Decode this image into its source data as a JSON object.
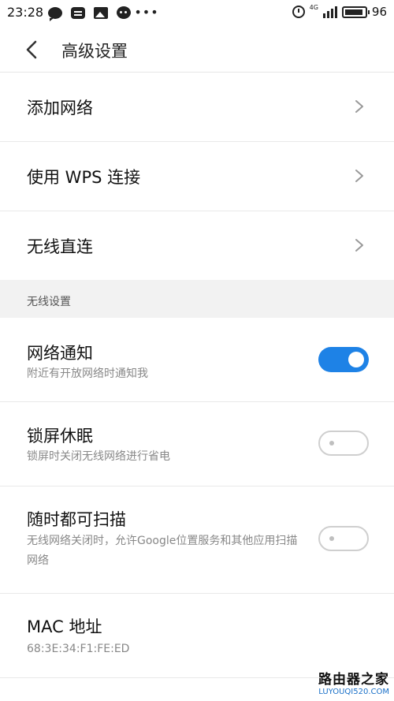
{
  "status_bar": {
    "time": "23:28",
    "network": "4G",
    "battery": "96",
    "icons": [
      "message-bubble-icon",
      "chat-square-icon",
      "image-icon",
      "chat-face-icon",
      "more-dots-icon",
      "alarm-icon",
      "signal-icon",
      "battery-icon"
    ]
  },
  "header": {
    "title": "高级设置"
  },
  "nav_rows": [
    {
      "label": "添加网络"
    },
    {
      "label": "使用 WPS 连接"
    },
    {
      "label": "无线直连"
    }
  ],
  "section": {
    "label": "无线设置"
  },
  "toggles": [
    {
      "label": "网络通知",
      "desc": "附近有开放网络时通知我",
      "on": true
    },
    {
      "label": "锁屏休眠",
      "desc": "锁屏时关闭无线网络进行省电",
      "on": false
    },
    {
      "label": "随时都可扫描",
      "desc": "无线网络关闭时，允许Google位置服务和其他应用扫描网络",
      "on": false
    }
  ],
  "mac": {
    "label": "MAC 地址",
    "value": "68:3E:34:F1:FE:ED"
  },
  "watermark": {
    "title": "路由器之家",
    "url": "LUYOUQI520.COM"
  },
  "colors": {
    "accent": "#1e82e6"
  }
}
